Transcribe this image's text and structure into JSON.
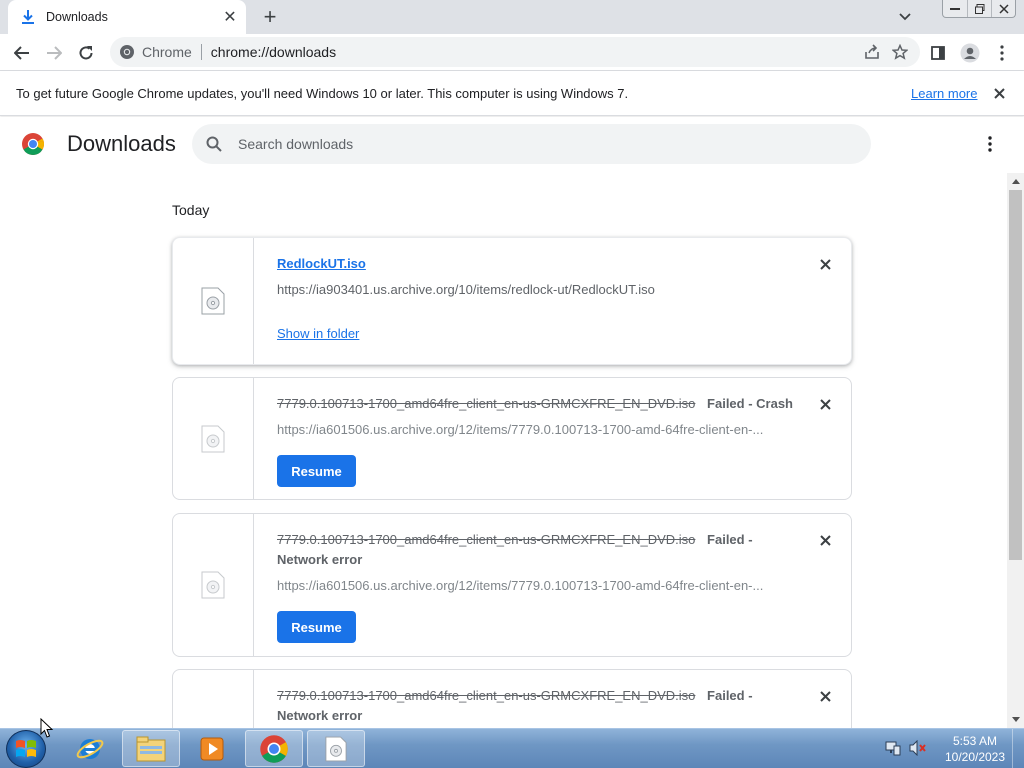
{
  "window": {
    "tab_title": "Downloads",
    "new_tab_label": "+",
    "close_tab_label": "✕"
  },
  "toolbar": {
    "site_chip": "Chrome",
    "url": "chrome://downloads"
  },
  "infobar": {
    "message": "To get future Google Chrome updates, you'll need Windows 10 or later. This computer is using Windows 7.",
    "link_label": "Learn more"
  },
  "downloads_page": {
    "title": "Downloads",
    "search_placeholder": "Search downloads",
    "section_label": "Today",
    "items": [
      {
        "filename": "RedlockUT.iso",
        "url": "https://ia903401.us.archive.org/10/items/redlock-ut/RedlockUT.iso",
        "action_label": "Show in folder",
        "status": ""
      },
      {
        "filename": "7779.0.100713-1700_amd64fre_client_en-us-GRMCXFRE_EN_DVD.iso",
        "status": "Failed - Crash",
        "url": "https://ia601506.us.archive.org/12/items/7779.0.100713-1700-amd-64fre-client-en-...",
        "action_label": "Resume"
      },
      {
        "filename": "7779.0.100713-1700_amd64fre_client_en-us-GRMCXFRE_EN_DVD.iso",
        "status_line1": "Failed -",
        "status_line2": "Network error",
        "url": "https://ia601506.us.archive.org/12/items/7779.0.100713-1700-amd-64fre-client-en-...",
        "action_label": "Resume"
      },
      {
        "filename": "7779.0.100713-1700_amd64fre_client_en-us-GRMCXFRE_EN_DVD.iso",
        "status_line1": "Failed -",
        "status_line2": "Network error"
      }
    ]
  },
  "taskbar": {
    "time": "5:53 AM",
    "date": "10/20/2023",
    "apps": [
      "internet-explorer",
      "file-explorer",
      "media-player",
      "chrome",
      "disc-image"
    ]
  },
  "colors": {
    "accent": "#1a73e8",
    "tabstrip": "#dee1e6",
    "omnibox": "#f1f3f4"
  }
}
